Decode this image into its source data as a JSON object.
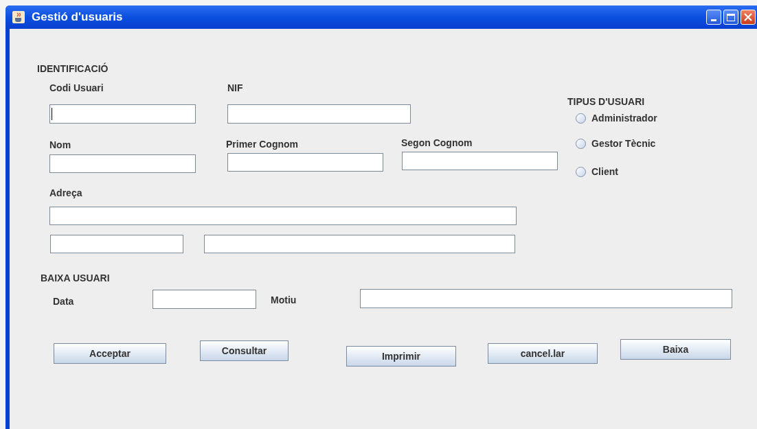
{
  "window": {
    "title": "Gestió d'usuaris"
  },
  "identificacio": {
    "title": "IDENTIFICACIÓ",
    "codi_usuari": {
      "label": "Codi Usuari",
      "focused": true
    },
    "nif": {
      "label": "NIF"
    },
    "nom": {
      "label": "Nom"
    },
    "primer_cognom": {
      "label": "Primer Cognom"
    },
    "segon_cognom": {
      "label": "Segon  Cognom"
    },
    "adreca": {
      "label": "Adreça"
    }
  },
  "tipus_usuari": {
    "title": "TIPUS D'USUARI",
    "options": [
      {
        "label": "Administrador",
        "selected": false
      },
      {
        "label": "Gestor Tècnic",
        "selected": false
      },
      {
        "label": "Client",
        "selected": false
      }
    ]
  },
  "baixa_usuari": {
    "title": "BAIXA USUARI",
    "data": {
      "label": "Data"
    },
    "motiu": {
      "label": "Motiu"
    }
  },
  "buttons": [
    {
      "label": "Acceptar"
    },
    {
      "label": "Consultar"
    },
    {
      "label": "Imprimir"
    },
    {
      "label": "cancel.lar"
    },
    {
      "label": "Baixa"
    }
  ]
}
